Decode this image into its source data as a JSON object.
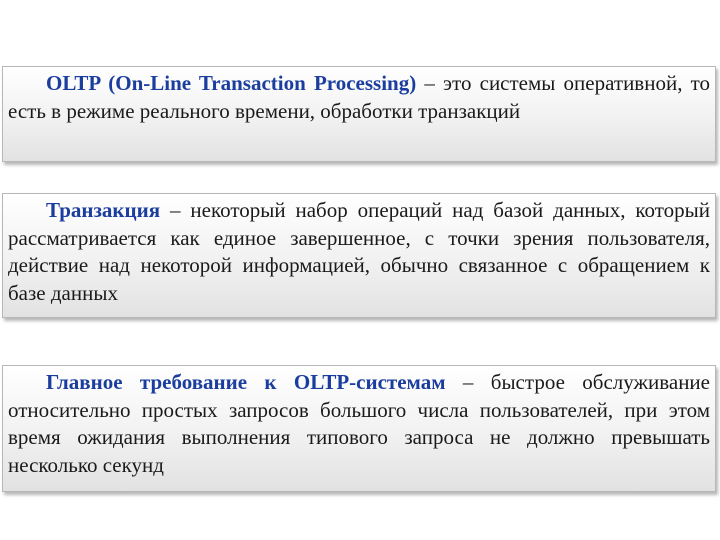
{
  "slide": {
    "number_glyph": "·"
  },
  "blocks": [
    {
      "term": "OLTP (On-Line Transaction Processing)",
      "text": " – это системы оперативной, то есть в режиме реального времени, обработки транзакций"
    },
    {
      "term": "Транзакция",
      "text": " – некоторый набор операций над базой данных, который рассматривается как единое завершенное, с точки зрения пользователя, действие над некоторой информацией, обычно связанное с обращением к базе данных"
    },
    {
      "term": "Главное требование к OLTP-системам",
      "text": " – быстрое обслуживание относительно простых запросов большого числа пользователей, при этом время ожидания выполнения типового запроса не должно превышать несколько секунд"
    }
  ],
  "colors": {
    "term": "#1a3d9e",
    "body_text": "#1a1a1a",
    "box_border": "#b7b7b7"
  }
}
